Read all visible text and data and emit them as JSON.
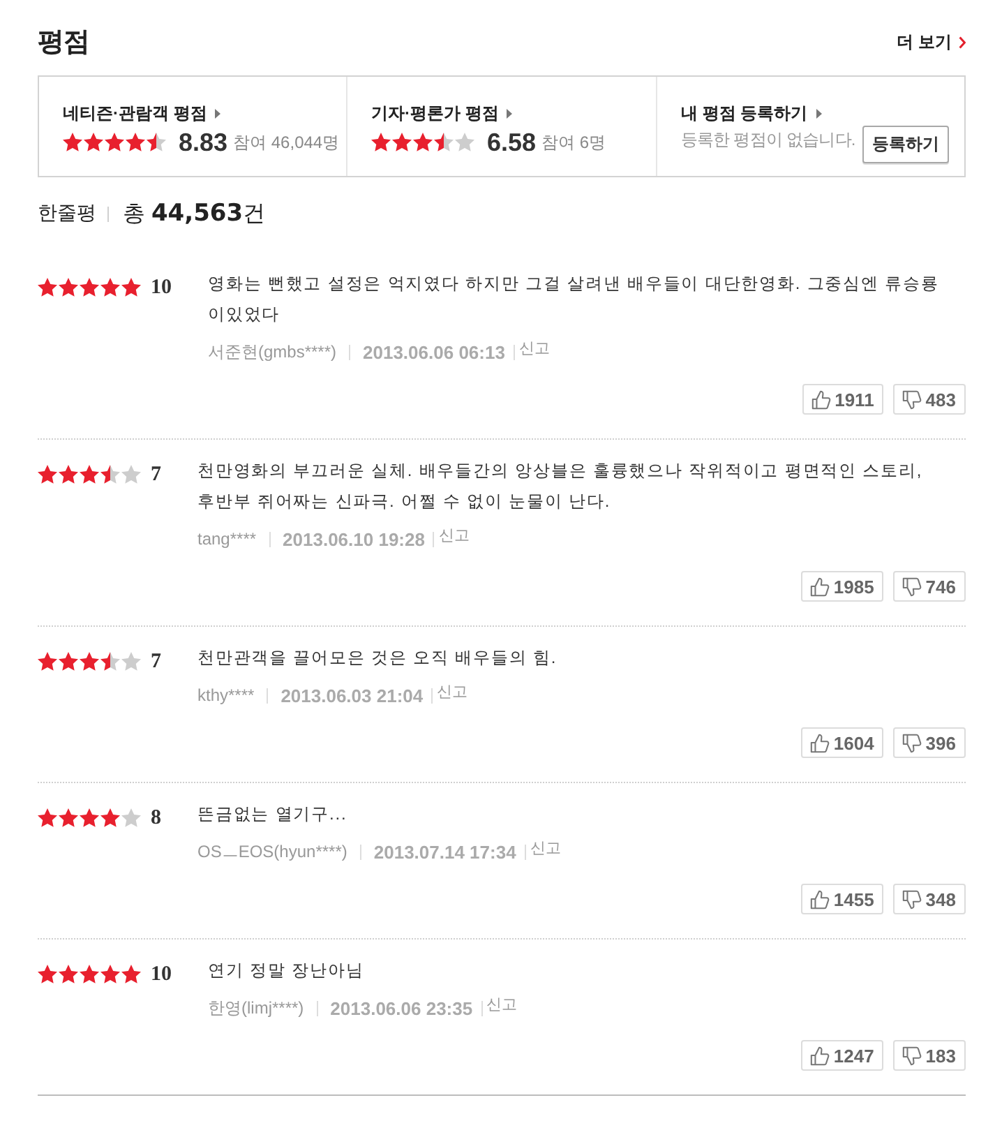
{
  "section": {
    "title": "평점",
    "more_link": "더 보기"
  },
  "summary": [
    {
      "kind": "rating",
      "title": "네티즌·관람객 평점",
      "stars": 4.5,
      "score": "8.83",
      "participants": "참여 46,044명"
    },
    {
      "kind": "rating",
      "title": "기자·평론가 평점",
      "stars": 3.5,
      "score": "6.58",
      "participants": "참여 6명"
    },
    {
      "kind": "register",
      "title": "내 평점 등록하기",
      "message": "등록한 평점이 없습니다.",
      "button": "등록하기"
    }
  ],
  "reviews_header": {
    "title": "한줄평",
    "count": "총 **44,563**건"
  },
  "reviews": [
    {
      "stars": 5,
      "score": "10",
      "text": "영화는 뻔했고 설정은 억지였다 하지만 그걸 살려낸 배우들이 대단한영화. 그중심엔 류승룡이있었다",
      "author": "서준현(gmbs****)",
      "date": "2013.06.06 06:13",
      "report": "신고",
      "likes": "1911",
      "dislikes": "483"
    },
    {
      "stars": 3.5,
      "score": "7",
      "text": "천만영화의 부끄러운 실체. 배우들간의 앙상블은 훌륭했으나 작위적이고 평면적인 스토리, 후반부 쥐어짜는 신파극. 어쩔 수 없이 눈물이 난다.",
      "author": "tang****",
      "date": "2013.06.10 19:28",
      "report": "신고",
      "likes": "1985",
      "dislikes": "746"
    },
    {
      "stars": 3.5,
      "score": "7",
      "text": "천만관객을 끌어모은 것은 오직 배우들의 힘.",
      "author": "kthy****",
      "date": "2013.06.03 21:04",
      "report": "신고",
      "likes": "1604",
      "dislikes": "396"
    },
    {
      "stars": 4,
      "score": "8",
      "text": "뜬금없는 열기구...",
      "author": "OSㅡEOS(hyun****)",
      "date": "2013.07.14 17:34",
      "report": "신고",
      "likes": "1455",
      "dislikes": "348"
    },
    {
      "stars": 5,
      "score": "10",
      "text": "연기 정말 장난아님",
      "author": "한영(limj****)",
      "date": "2013.06.06 23:35",
      "report": "신고",
      "likes": "1247",
      "dislikes": "183"
    }
  ]
}
